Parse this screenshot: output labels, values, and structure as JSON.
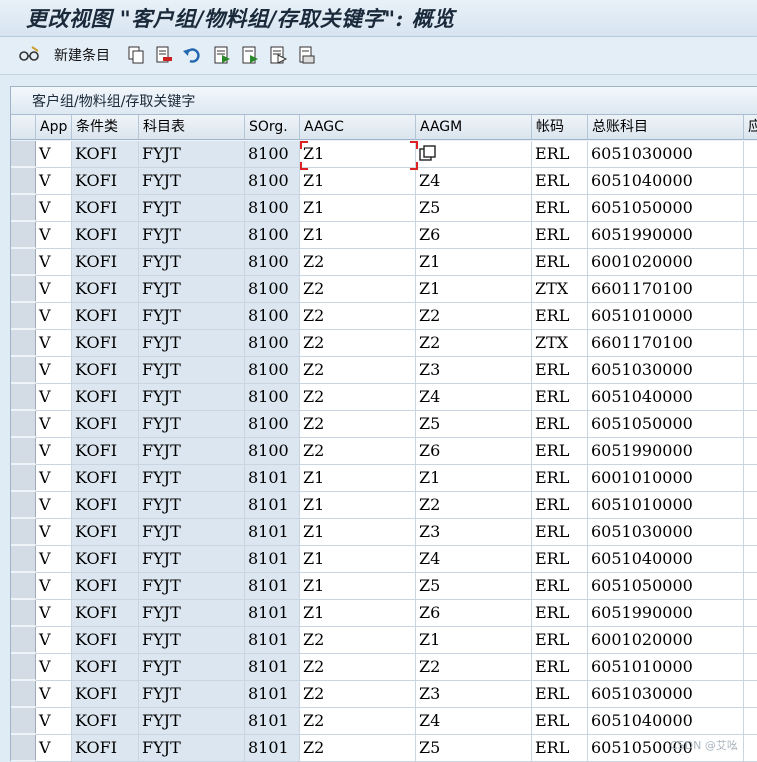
{
  "window": {
    "title": "更改视图 \"客户组/物料组/存取关键字\": 概览"
  },
  "toolbar": {
    "new_entries_label": "新建条目",
    "icons": [
      "glasses-icon",
      "copy-icon",
      "delete-icon",
      "undo-icon",
      "select-all-icon",
      "select-block-icon",
      "deselect-icon",
      "print-icon"
    ]
  },
  "panel": {
    "title": "客户组/物料组/存取关键字"
  },
  "table": {
    "columns": [
      "App",
      "条件类",
      "科目表",
      "SOrg.",
      "AAGC",
      "AAGM",
      "帐码",
      "总账科目",
      "应"
    ],
    "rows": [
      [
        "V",
        "KOFI",
        "FYJT",
        "8100",
        "Z1",
        "",
        "ERL",
        "6051030000"
      ],
      [
        "V",
        "KOFI",
        "FYJT",
        "8100",
        "Z1",
        "Z4",
        "ERL",
        "6051040000"
      ],
      [
        "V",
        "KOFI",
        "FYJT",
        "8100",
        "Z1",
        "Z5",
        "ERL",
        "6051050000"
      ],
      [
        "V",
        "KOFI",
        "FYJT",
        "8100",
        "Z1",
        "Z6",
        "ERL",
        "6051990000"
      ],
      [
        "V",
        "KOFI",
        "FYJT",
        "8100",
        "Z2",
        "Z1",
        "ERL",
        "6001020000"
      ],
      [
        "V",
        "KOFI",
        "FYJT",
        "8100",
        "Z2",
        "Z1",
        "ZTX",
        "6601170100"
      ],
      [
        "V",
        "KOFI",
        "FYJT",
        "8100",
        "Z2",
        "Z2",
        "ERL",
        "6051010000"
      ],
      [
        "V",
        "KOFI",
        "FYJT",
        "8100",
        "Z2",
        "Z2",
        "ZTX",
        "6601170100"
      ],
      [
        "V",
        "KOFI",
        "FYJT",
        "8100",
        "Z2",
        "Z3",
        "ERL",
        "6051030000"
      ],
      [
        "V",
        "KOFI",
        "FYJT",
        "8100",
        "Z2",
        "Z4",
        "ERL",
        "6051040000"
      ],
      [
        "V",
        "KOFI",
        "FYJT",
        "8100",
        "Z2",
        "Z5",
        "ERL",
        "6051050000"
      ],
      [
        "V",
        "KOFI",
        "FYJT",
        "8100",
        "Z2",
        "Z6",
        "ERL",
        "6051990000"
      ],
      [
        "V",
        "KOFI",
        "FYJT",
        "8101",
        "Z1",
        "Z1",
        "ERL",
        "6001010000"
      ],
      [
        "V",
        "KOFI",
        "FYJT",
        "8101",
        "Z1",
        "Z2",
        "ERL",
        "6051010000"
      ],
      [
        "V",
        "KOFI",
        "FYJT",
        "8101",
        "Z1",
        "Z3",
        "ERL",
        "6051030000"
      ],
      [
        "V",
        "KOFI",
        "FYJT",
        "8101",
        "Z1",
        "Z4",
        "ERL",
        "6051040000"
      ],
      [
        "V",
        "KOFI",
        "FYJT",
        "8101",
        "Z1",
        "Z5",
        "ERL",
        "6051050000"
      ],
      [
        "V",
        "KOFI",
        "FYJT",
        "8101",
        "Z1",
        "Z6",
        "ERL",
        "6051990000"
      ],
      [
        "V",
        "KOFI",
        "FYJT",
        "8101",
        "Z2",
        "Z1",
        "ERL",
        "6001020000"
      ],
      [
        "V",
        "KOFI",
        "FYJT",
        "8101",
        "Z2",
        "Z2",
        "ERL",
        "6051010000"
      ],
      [
        "V",
        "KOFI",
        "FYJT",
        "8101",
        "Z2",
        "Z3",
        "ERL",
        "6051030000"
      ],
      [
        "V",
        "KOFI",
        "FYJT",
        "8101",
        "Z2",
        "Z4",
        "ERL",
        "6051040000"
      ],
      [
        "V",
        "KOFI",
        "FYJT",
        "8101",
        "Z2",
        "Z5",
        "ERL",
        "6051050000"
      ]
    ]
  },
  "watermark": "CSDN @艾吆"
}
